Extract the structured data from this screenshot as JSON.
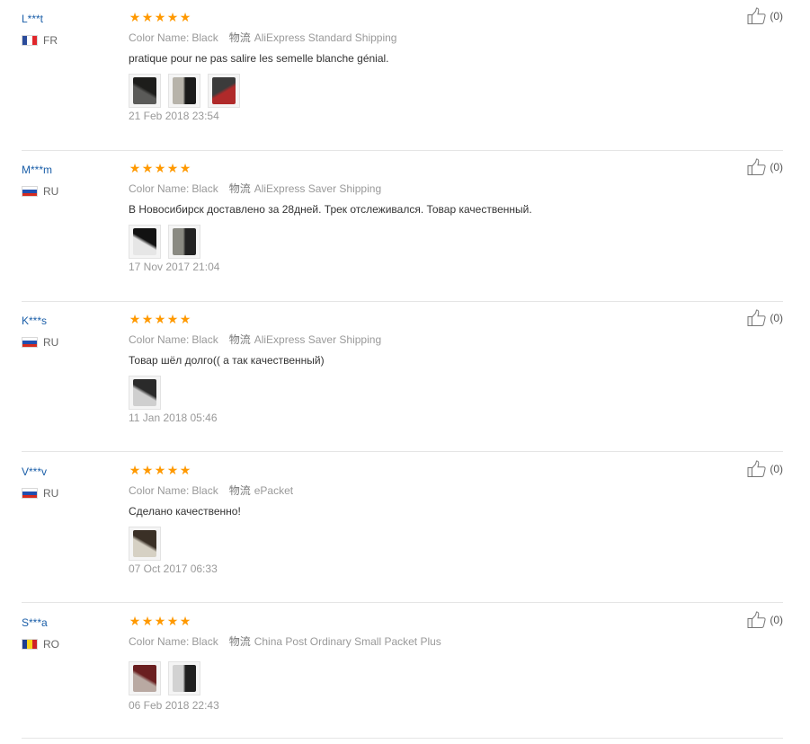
{
  "labels": {
    "color_name": "Color Name:",
    "logistics": "物流"
  },
  "reviews": [
    {
      "user": "L***t",
      "country": "FR",
      "flag": [
        "#2b4c9b",
        "#ffffff",
        "#e0262b"
      ],
      "flag_dir": "v",
      "stars": 5,
      "color": "Black",
      "shipping": "AliExpress Standard Shipping",
      "text": "pratique pour ne pas salire les semelle blanche génial.",
      "images": [
        {
          "colors": [
            "#5a5a58",
            "#1d1d1b"
          ]
        },
        {
          "colors": [
            "#b7b3aa",
            "#1a1a1a"
          ]
        },
        {
          "colors": [
            "#3b3b3b",
            "#b02a2a"
          ]
        }
      ],
      "date": "21 Feb 2018 23:54",
      "likes": "(0)"
    },
    {
      "user": "M***m",
      "country": "RU",
      "flag": [
        "#ffffff",
        "#1f4fb0",
        "#d52b1e"
      ],
      "flag_dir": "h",
      "stars": 5,
      "color": "Black",
      "shipping": "AliExpress Saver Shipping",
      "text": "В Новосибирск доставлено за 28дней. Трек отслеживался. Товар качественный.",
      "images": [
        {
          "colors": [
            "#e6e6e6",
            "#121212"
          ]
        },
        {
          "colors": [
            "#8a8a82",
            "#222222"
          ]
        }
      ],
      "date": "17 Nov 2017 21:04",
      "likes": "(0)"
    },
    {
      "user": "K***s",
      "country": "RU",
      "flag": [
        "#ffffff",
        "#1f4fb0",
        "#d52b1e"
      ],
      "flag_dir": "h",
      "stars": 5,
      "color": "Black",
      "shipping": "AliExpress Saver Shipping",
      "text": "Товар шёл долго(( а так качественный)",
      "images": [
        {
          "colors": [
            "#cfcfcf",
            "#2a2a2a"
          ]
        }
      ],
      "date": "11 Jan 2018 05:46",
      "likes": "(0)"
    },
    {
      "user": "V***v",
      "country": "RU",
      "flag": [
        "#ffffff",
        "#1f4fb0",
        "#d52b1e"
      ],
      "flag_dir": "h",
      "stars": 5,
      "color": "Black",
      "shipping": "ePacket",
      "text": "Сделано качественно!",
      "images": [
        {
          "colors": [
            "#d6d1c4",
            "#3a3026"
          ]
        }
      ],
      "date": "07 Oct 2017 06:33",
      "likes": "(0)"
    },
    {
      "user": "S***a",
      "country": "RO",
      "flag": [
        "#1d3d8f",
        "#f6d21a",
        "#cf2027"
      ],
      "flag_dir": "v",
      "stars": 5,
      "color": "Black",
      "shipping": "China Post Ordinary Small Packet Plus",
      "text": "",
      "images": [
        {
          "colors": [
            "#b9a9a2",
            "#6a1f20"
          ]
        },
        {
          "colors": [
            "#d2d2d2",
            "#202020"
          ]
        }
      ],
      "date": "06 Feb 2018 22:43",
      "likes": "(0)"
    }
  ]
}
